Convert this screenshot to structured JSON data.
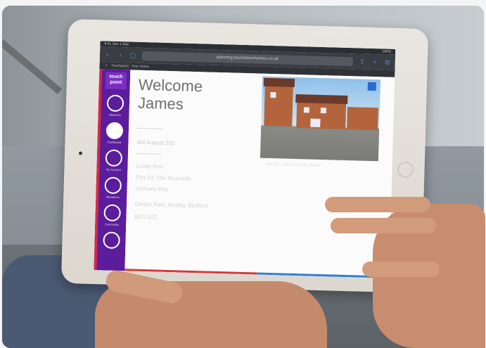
{
  "browser": {
    "status_left": "9:41 Sun 1 Sep",
    "status_right": "100%",
    "url": "planning.touchstonehomes.co.uk",
    "tab_title": "Touchpoint · Your Home"
  },
  "sidebar": {
    "logo": "touch point",
    "items": [
      {
        "label": "Welcome",
        "active": false
      },
      {
        "label": "Dashboard",
        "active": true
      },
      {
        "label": "My Account",
        "active": false
      },
      {
        "label": "Alterations",
        "active": false
      },
      {
        "label": "Community",
        "active": false
      },
      {
        "label": "",
        "active": false
      }
    ]
  },
  "main": {
    "welcome_line1": "Welcome",
    "welcome_line2": "James",
    "date": "3rd August 202",
    "address_lines": [
      "Lower Port",
      "Plot 23, The Riverside",
      "Orchard Way",
      "Dorton Park, Bodley, Bedford",
      "BD1 0ZZ"
    ],
    "photo_caption": "Plot 23 · view from the street"
  },
  "colors": {
    "sidebar": "#5b1d9c",
    "accent_red": "#d42a48",
    "accent_blue": "#2f7fd1",
    "browser_link": "#5a8fd8"
  }
}
